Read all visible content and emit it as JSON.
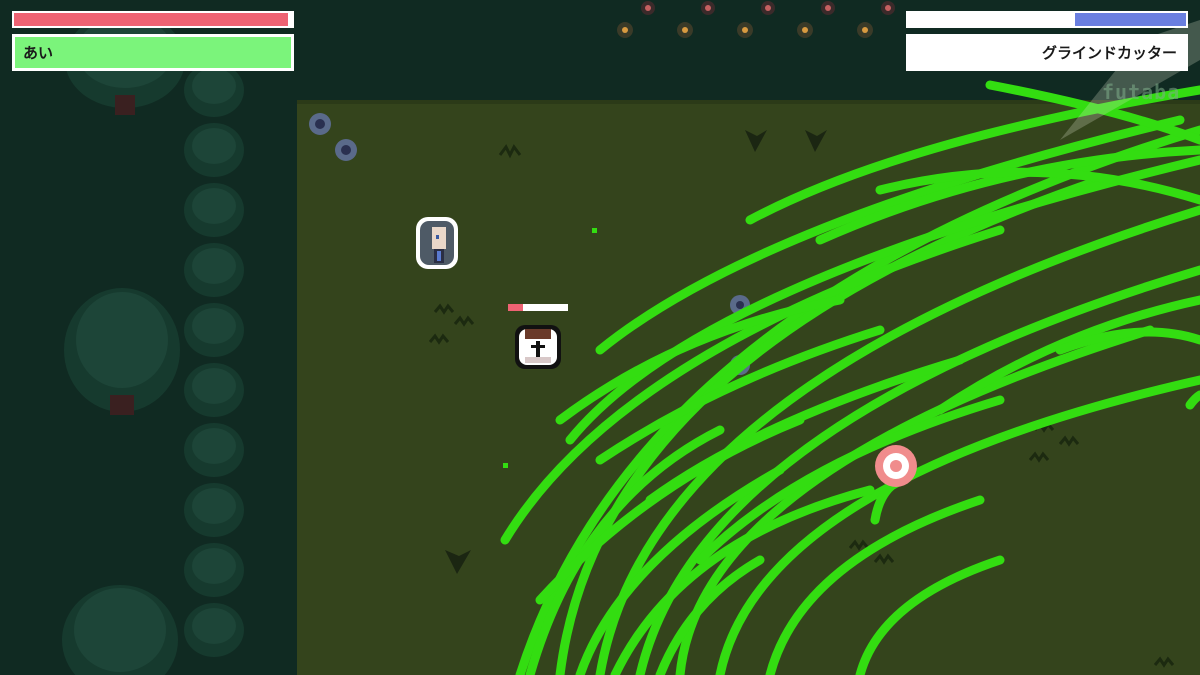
{
  "player": {
    "name": "あい",
    "hp_fraction": 0.985,
    "hp_color": "#ee6373",
    "name_panel_color": "#7bf47b"
  },
  "enemy": {
    "skill_name": "グラインドカッター",
    "mp_fraction": 0.4,
    "mp_color": "#6a7fe0",
    "name_panel_color": "#ffffff",
    "overhead_hp_fraction": 0.25
  },
  "watermark": "futaba",
  "colors": {
    "field": "#33431c",
    "forest": "#123026",
    "tree": "#1d4538",
    "slash": "#33dd11",
    "target_ring": "#f08c8c"
  },
  "icons": [
    "tree-icon",
    "flower-icon",
    "grass-tuft-icon",
    "player-character-icon",
    "enemy-character-icon",
    "target-reticle-icon",
    "slash-effect-icon"
  ]
}
